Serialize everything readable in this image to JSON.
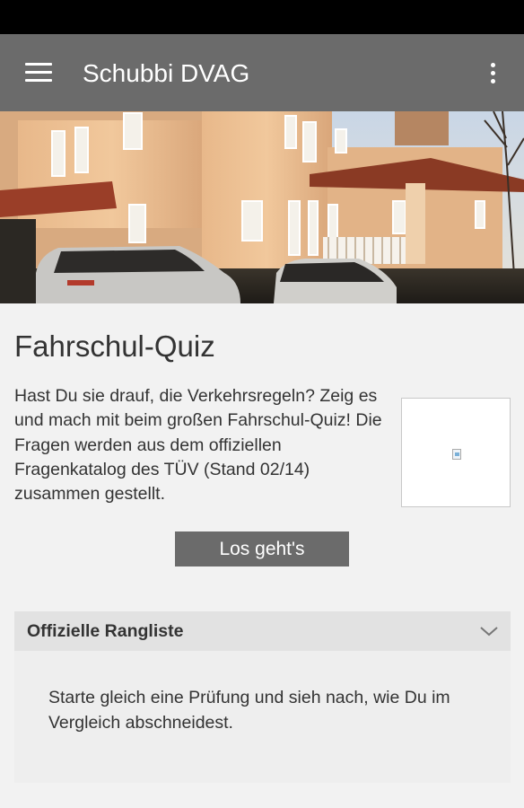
{
  "app": {
    "title": "Schubbi DVAG"
  },
  "icons": {
    "menu": "hamburger-menu-icon",
    "overflow": "more-vert-icon",
    "expand": "chevron-down-icon",
    "thumbnail": "broken-image-icon"
  },
  "colors": {
    "app_bar": "#6b6b6b",
    "button": "#6b6b6b",
    "background": "#f2f2f2"
  },
  "content": {
    "title": "Fahrschul-Quiz",
    "description": "Hast Du sie drauf, die Verkehrsregeln? Zeig es und mach mit beim großen Fahrschul-Quiz! Die Fragen werden aus dem offiziellen Fragenkatalog des TÜV (Stand 02/14) zusammen gestellt.",
    "start_label": "Los geht's"
  },
  "ranking": {
    "title": "Offizielle Rangliste",
    "text": "Starte gleich eine Prüfung und sieh nach, wie Du im Vergleich abschneidest."
  }
}
